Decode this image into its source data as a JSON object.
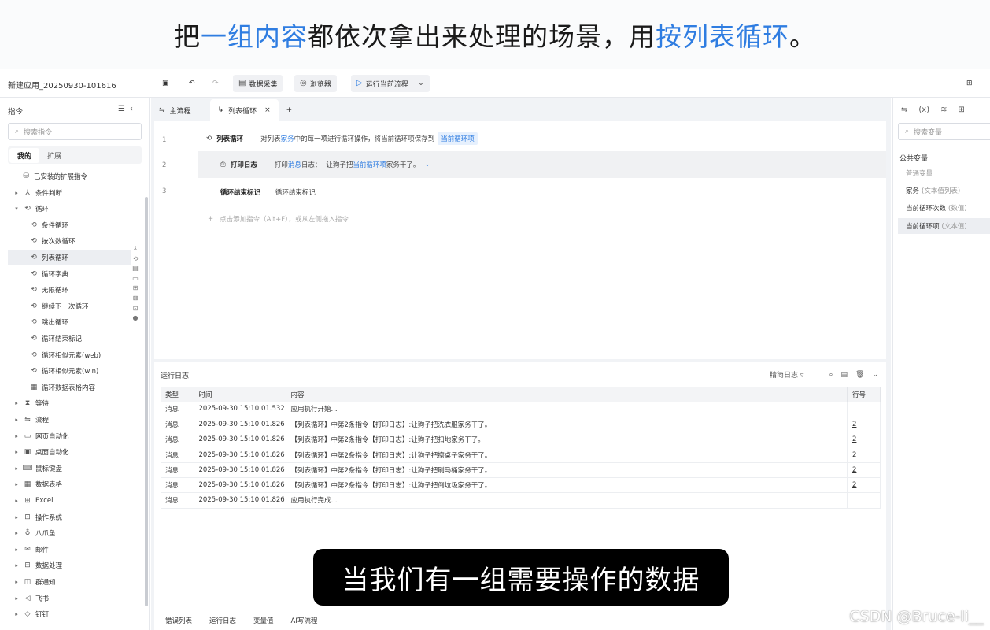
{
  "banner": {
    "p1": "把",
    "h1": "一组内容",
    "p2": "都依次拿出来处理的场景，用",
    "h2": "按列表循环",
    "p3": "。"
  },
  "app": {
    "title": "新建应用_20250930-101616"
  },
  "toolbar": {
    "data_collect": "数据采集",
    "browser": "浏览器",
    "run": "运行当前流程"
  },
  "left": {
    "header": "指令",
    "search_placeholder": "搜索指令",
    "seg_mine": "我的",
    "seg_ext": "扩展",
    "items": [
      {
        "label": "已安装的扩展指令",
        "icon": "extension-icon",
        "level": 1,
        "arrow": ""
      },
      {
        "label": "条件判断",
        "icon": "branch-icon",
        "level": 0,
        "arrow": "▸"
      },
      {
        "label": "循环",
        "icon": "loop-icon",
        "level": 0,
        "arrow": "▾"
      },
      {
        "label": "条件循环",
        "icon": "loop-icon",
        "level": 2,
        "arrow": ""
      },
      {
        "label": "按次数循环",
        "icon": "loop-icon",
        "level": 2,
        "arrow": ""
      },
      {
        "label": "列表循环",
        "icon": "loop-icon",
        "level": 2,
        "arrow": "",
        "selected": true
      },
      {
        "label": "循环字典",
        "icon": "loop-icon",
        "level": 2,
        "arrow": ""
      },
      {
        "label": "无限循环",
        "icon": "loop-icon",
        "level": 2,
        "arrow": ""
      },
      {
        "label": "继续下一次循环",
        "icon": "loop-icon",
        "level": 2,
        "arrow": ""
      },
      {
        "label": "跳出循环",
        "icon": "loop-icon",
        "level": 2,
        "arrow": ""
      },
      {
        "label": "循环结束标记",
        "icon": "loop-icon",
        "level": 2,
        "arrow": ""
      },
      {
        "label": "循环相似元素(web)",
        "icon": "loop-icon",
        "level": 2,
        "arrow": ""
      },
      {
        "label": "循环相似元素(win)",
        "icon": "loop-icon",
        "level": 2,
        "arrow": ""
      },
      {
        "label": "循环数据表格内容",
        "icon": "table-icon",
        "level": 2,
        "arrow": ""
      },
      {
        "label": "等待",
        "icon": "hourglass-icon",
        "level": 0,
        "arrow": "▸"
      },
      {
        "label": "流程",
        "icon": "flow-icon",
        "level": 0,
        "arrow": "▸"
      },
      {
        "label": "网页自动化",
        "icon": "web-icon",
        "level": 0,
        "arrow": "▸"
      },
      {
        "label": "桌面自动化",
        "icon": "desktop-icon",
        "level": 0,
        "arrow": "▸"
      },
      {
        "label": "鼠标键盘",
        "icon": "keyboard-icon",
        "level": 0,
        "arrow": "▸"
      },
      {
        "label": "数据表格",
        "icon": "table-icon",
        "level": 0,
        "arrow": "▸"
      },
      {
        "label": "Excel",
        "icon": "excel-icon",
        "level": 0,
        "arrow": "▸"
      },
      {
        "label": "操作系统",
        "icon": "os-icon",
        "level": 0,
        "arrow": "▸"
      },
      {
        "label": "八爪鱼",
        "icon": "octopus-icon",
        "level": 0,
        "arrow": "▸"
      },
      {
        "label": "邮件",
        "icon": "mail-icon",
        "level": 0,
        "arrow": "▸"
      },
      {
        "label": "数据处理",
        "icon": "data-icon",
        "level": 0,
        "arrow": "▸"
      },
      {
        "label": "群通知",
        "icon": "notify-icon",
        "level": 0,
        "arrow": "▸"
      },
      {
        "label": "飞书",
        "icon": "feishu-icon",
        "level": 0,
        "arrow": "▸"
      },
      {
        "label": "钉钉",
        "icon": "dingtalk-icon",
        "level": 0,
        "arrow": "▸"
      }
    ]
  },
  "tabs": {
    "main": "主流程",
    "loop": "列表循环"
  },
  "editor": {
    "r1_title": "列表循环",
    "r1_a": "对列表",
    "r1_var": "家务",
    "r1_b": "中的每一项进行循环操作，将当前循环项保存到",
    "r1_pill": "当前循环项",
    "r2_title": "打印日志",
    "r2_a": "打印",
    "r2_b": "消息",
    "r2_c": "日志：",
    "r2_d": "让狗子把",
    "r2_e": "当前循环项",
    "r2_f": "家务干了。",
    "r3_title": "循环结束标记",
    "r3_desc": "循环结束标记",
    "add_hint": "点击添加指令（Alt+F），或从左侧拖入指令"
  },
  "log": {
    "title": "运行日志",
    "filter": "精简日志",
    "cols": {
      "type": "类型",
      "time": "时间",
      "content": "内容",
      "line": "行号"
    },
    "rows": [
      {
        "type": "消息",
        "time": "2025-09-30 15:10:01.532",
        "content": "应用执行开始...",
        "line": ""
      },
      {
        "type": "消息",
        "time": "2025-09-30 15:10:01.826",
        "content": "【列表循环】中第2条指令【打印日志】:让狗子把洗衣服家务干了。",
        "line": "2"
      },
      {
        "type": "消息",
        "time": "2025-09-30 15:10:01.826",
        "content": "【列表循环】中第2条指令【打印日志】:让狗子把扫地家务干了。",
        "line": "2"
      },
      {
        "type": "消息",
        "time": "2025-09-30 15:10:01.826",
        "content": "【列表循环】中第2条指令【打印日志】:让狗子把擦桌子家务干了。",
        "line": "2"
      },
      {
        "type": "消息",
        "time": "2025-09-30 15:10:01.826",
        "content": "【列表循环】中第2条指令【打印日志】:让狗子把刷马桶家务干了。",
        "line": "2"
      },
      {
        "type": "消息",
        "time": "2025-09-30 15:10:01.826",
        "content": "【列表循环】中第2条指令【打印日志】:让狗子把倒垃圾家务干了。",
        "line": "2"
      },
      {
        "type": "消息",
        "time": "2025-09-30 15:10:01.826",
        "content": "应用执行完成...",
        "line": ""
      }
    ],
    "bottom_tabs": [
      "错误列表",
      "运行日志",
      "变量值",
      "AI写流程"
    ]
  },
  "right": {
    "search_placeholder": "搜索变量",
    "section": "公共变量",
    "normal": "普通变量",
    "vars": [
      {
        "name": "家务",
        "type": "(文本值列表)"
      },
      {
        "name": "当前循环次数",
        "type": "(数值)"
      },
      {
        "name": "当前循环项",
        "type": "(文本值)"
      }
    ]
  },
  "subtitle": "当我们有一组需要操作的数据",
  "watermark": "CSDN @Bruce-li__"
}
